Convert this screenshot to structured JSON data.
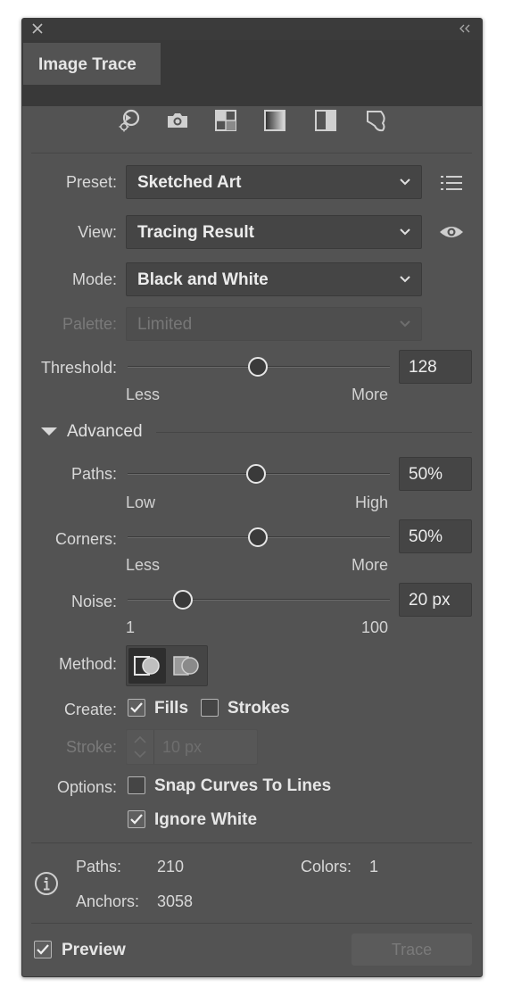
{
  "panel": {
    "tab_title": "Image Trace",
    "preset_icons": [
      "auto-color-icon",
      "high-color-icon",
      "low-color-icon",
      "grayscale-icon",
      "black-and-white-icon",
      "outline-icon"
    ]
  },
  "preset": {
    "label": "Preset:",
    "value": "Sketched Art"
  },
  "view": {
    "label": "View:",
    "value": "Tracing Result"
  },
  "mode": {
    "label": "Mode:",
    "value": "Black and White"
  },
  "palette": {
    "label": "Palette:",
    "value": "Limited",
    "disabled": true
  },
  "threshold": {
    "label": "Threshold:",
    "value": "128",
    "level": 0.5,
    "min_label": "Less",
    "max_label": "More"
  },
  "advanced": {
    "label": "Advanced",
    "expanded": true
  },
  "paths": {
    "label": "Paths:",
    "value": "50%",
    "level": 0.5,
    "min_label": "Low",
    "max_label": "High"
  },
  "corners": {
    "label": "Corners:",
    "value": "50%",
    "level": 0.5,
    "min_label": "Less",
    "max_label": "More"
  },
  "noise": {
    "label": "Noise:",
    "value": "20 px",
    "level": 0.2,
    "min_label": "1",
    "max_label": "100"
  },
  "method": {
    "label": "Method:",
    "selected": "abutting"
  },
  "create": {
    "label": "Create:",
    "fills_label": "Fills",
    "fills_checked": true,
    "strokes_label": "Strokes",
    "strokes_checked": false
  },
  "stroke": {
    "label": "Stroke:",
    "value": "10 px",
    "disabled": true
  },
  "options": {
    "label": "Options:",
    "snap_label": "Snap Curves To Lines",
    "snap_checked": false,
    "ignore_white_label": "Ignore White",
    "ignore_white_checked": true
  },
  "stats": {
    "paths_label": "Paths:",
    "paths_value": "210",
    "colors_label": "Colors:",
    "colors_value": "1",
    "anchors_label": "Anchors:",
    "anchors_value": "3058"
  },
  "footer": {
    "preview_label": "Preview",
    "preview_checked": true,
    "trace_label": "Trace",
    "trace_disabled": true
  },
  "colors": {
    "panel_bg": "#535353",
    "field_bg": "#454545",
    "text": "#dcdcdc",
    "disabled_text": "#7a7a7a"
  }
}
